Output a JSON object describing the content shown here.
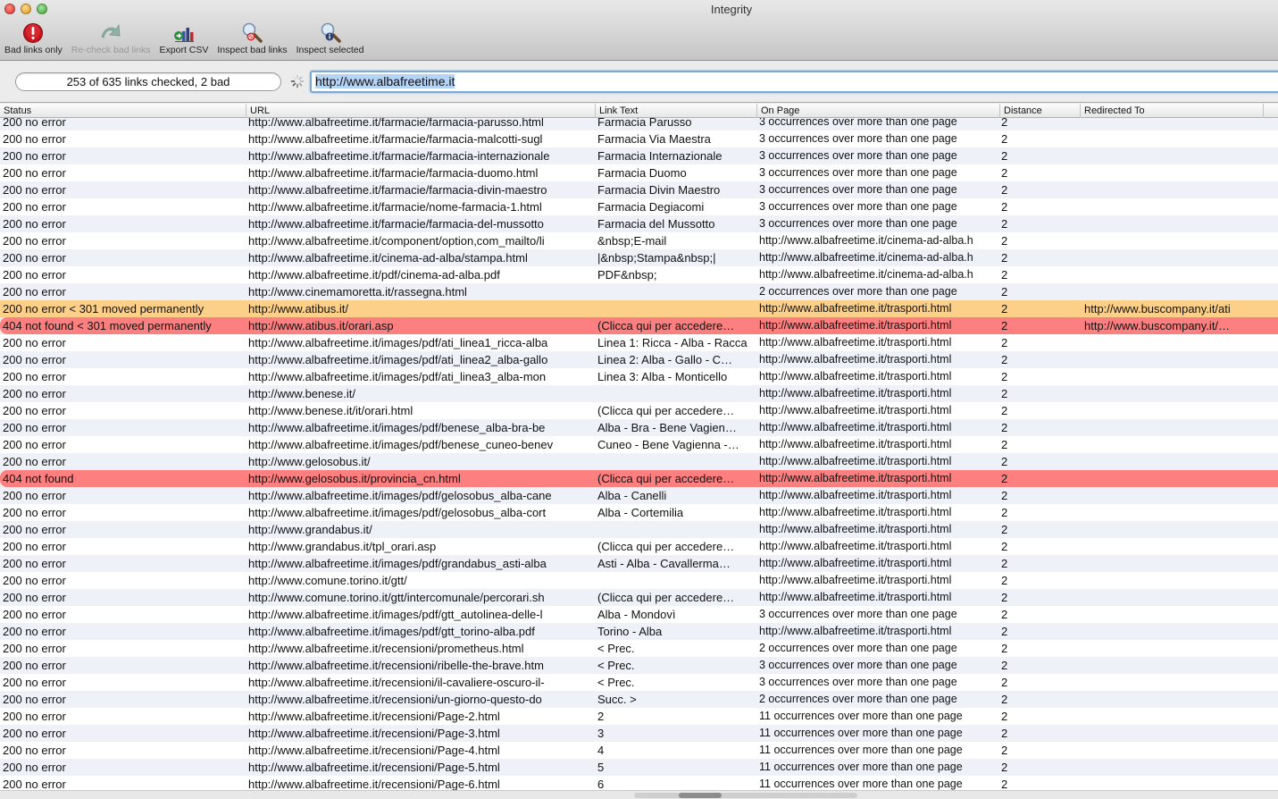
{
  "window": {
    "title": "Integrity"
  },
  "toolbar": {
    "items": [
      {
        "label": "Bad links only",
        "icon": "alert-icon",
        "enabled": true
      },
      {
        "label": "Re-check bad links",
        "icon": "recheck-arrow-icon",
        "enabled": false
      },
      {
        "label": "Export CSV",
        "icon": "export-chart-icon",
        "enabled": true
      },
      {
        "label": "Inspect bad links",
        "icon": "magnifier-bad-icon",
        "enabled": true
      },
      {
        "label": "Inspect selected",
        "icon": "magnifier-info-icon",
        "enabled": true
      }
    ]
  },
  "status": {
    "progress_text": "253 of 635 links checked, 2 bad",
    "checked": 253,
    "total": 635,
    "bad": 2,
    "spinner": "loading-spinner-icon"
  },
  "url_field": {
    "value": "http://www.albafreetime.it"
  },
  "columns": [
    "Status",
    "URL",
    "Link Text",
    "On Page",
    "Distance",
    "Redirected To"
  ],
  "colors": {
    "warn_row": "#fdd08a",
    "bad_row": "#fd7f7f",
    "alt_row": "#eef2f8",
    "focus_ring": "#7fa8d8"
  },
  "rows": [
    {
      "status": "200 no error",
      "url": "http://www.albafreetime.it/farmacie/farmacia-parusso.html",
      "text": "Farmacia Parusso",
      "page": "3 occurrences over more than one page",
      "dist": "2",
      "redir": "",
      "kind": "ok"
    },
    {
      "status": "200 no error",
      "url": "http://www.albafreetime.it/farmacie/farmacia-malcotti-sugl",
      "text": "Farmacia Via Maestra",
      "page": "3 occurrences over more than one page",
      "dist": "2",
      "redir": "",
      "kind": "ok"
    },
    {
      "status": "200 no error",
      "url": "http://www.albafreetime.it/farmacie/farmacia-internazionale",
      "text": "Farmacia Internazionale",
      "page": "3 occurrences over more than one page",
      "dist": "2",
      "redir": "",
      "kind": "ok"
    },
    {
      "status": "200 no error",
      "url": "http://www.albafreetime.it/farmacie/farmacia-duomo.html",
      "text": "Farmacia Duomo",
      "page": "3 occurrences over more than one page",
      "dist": "2",
      "redir": "",
      "kind": "ok"
    },
    {
      "status": "200 no error",
      "url": "http://www.albafreetime.it/farmacie/farmacia-divin-maestro",
      "text": "Farmacia Divin Maestro",
      "page": "3 occurrences over more than one page",
      "dist": "2",
      "redir": "",
      "kind": "ok"
    },
    {
      "status": "200 no error",
      "url": "http://www.albafreetime.it/farmacie/nome-farmacia-1.html",
      "text": "Farmacia Degiacomi",
      "page": "3 occurrences over more than one page",
      "dist": "2",
      "redir": "",
      "kind": "ok"
    },
    {
      "status": "200 no error",
      "url": "http://www.albafreetime.it/farmacie/farmacia-del-mussotto",
      "text": "Farmacia del Mussotto",
      "page": "3 occurrences over more than one page",
      "dist": "2",
      "redir": "",
      "kind": "ok"
    },
    {
      "status": "200 no error",
      "url": "http://www.albafreetime.it/component/option,com_mailto/li",
      "text": "&nbsp;E-mail",
      "page": "http://www.albafreetime.it/cinema-ad-alba.h",
      "dist": "2",
      "redir": "",
      "kind": "ok"
    },
    {
      "status": "200 no error",
      "url": "http://www.albafreetime.it/cinema-ad-alba/stampa.html",
      "text": "|&nbsp;Stampa&nbsp;|",
      "page": "http://www.albafreetime.it/cinema-ad-alba.h",
      "dist": "2",
      "redir": "",
      "kind": "ok"
    },
    {
      "status": "200 no error",
      "url": "http://www.albafreetime.it/pdf/cinema-ad-alba.pdf",
      "text": "PDF&nbsp;",
      "page": "http://www.albafreetime.it/cinema-ad-alba.h",
      "dist": "2",
      "redir": "",
      "kind": "ok"
    },
    {
      "status": "200 no error",
      "url": "http://www.cinemamoretta.it/rassegna.html",
      "text": "",
      "page": "2 occurrences over more than one page",
      "dist": "2",
      "redir": "",
      "kind": "ok"
    },
    {
      "status": "200 no error < 301 moved permanently",
      "url": "http://www.atibus.it/",
      "text": "",
      "page": "http://www.albafreetime.it/trasporti.html",
      "dist": "2",
      "redir": "http://www.buscompany.it/ati",
      "kind": "warn"
    },
    {
      "status": "404 not found < 301 moved permanently",
      "url": "http://www.atibus.it/orari.asp",
      "text": "(Clicca qui per accedere…",
      "page": "http://www.albafreetime.it/trasporti.html",
      "dist": "2",
      "redir": "http://www.buscompany.it/…",
      "kind": "bad"
    },
    {
      "status": "200 no error",
      "url": "http://www.albafreetime.it/images/pdf/ati_linea1_ricca-alba",
      "text": "Linea 1: Ricca - Alba - Racca",
      "page": "http://www.albafreetime.it/trasporti.html",
      "dist": "2",
      "redir": "",
      "kind": "ok"
    },
    {
      "status": "200 no error",
      "url": "http://www.albafreetime.it/images/pdf/ati_linea2_alba-gallo",
      "text": "Linea 2: Alba - Gallo - C…",
      "page": "http://www.albafreetime.it/trasporti.html",
      "dist": "2",
      "redir": "",
      "kind": "ok"
    },
    {
      "status": "200 no error",
      "url": "http://www.albafreetime.it/images/pdf/ati_linea3_alba-mon",
      "text": "Linea 3: Alba - Monticello",
      "page": "http://www.albafreetime.it/trasporti.html",
      "dist": "2",
      "redir": "",
      "kind": "ok"
    },
    {
      "status": "200 no error",
      "url": "http://www.benese.it/",
      "text": "",
      "page": "http://www.albafreetime.it/trasporti.html",
      "dist": "2",
      "redir": "",
      "kind": "ok"
    },
    {
      "status": "200 no error",
      "url": "http://www.benese.it/it/orari.html",
      "text": "(Clicca qui per accedere…",
      "page": "http://www.albafreetime.it/trasporti.html",
      "dist": "2",
      "redir": "",
      "kind": "ok"
    },
    {
      "status": "200 no error",
      "url": "http://www.albafreetime.it/images/pdf/benese_alba-bra-be",
      "text": "Alba - Bra - Bene Vagien…",
      "page": "http://www.albafreetime.it/trasporti.html",
      "dist": "2",
      "redir": "",
      "kind": "ok"
    },
    {
      "status": "200 no error",
      "url": "http://www.albafreetime.it/images/pdf/benese_cuneo-benev",
      "text": "Cuneo - Bene Vagienna -…",
      "page": "http://www.albafreetime.it/trasporti.html",
      "dist": "2",
      "redir": "",
      "kind": "ok"
    },
    {
      "status": "200 no error",
      "url": "http://www.gelosobus.it/",
      "text": "",
      "page": "http://www.albafreetime.it/trasporti.html",
      "dist": "2",
      "redir": "",
      "kind": "ok"
    },
    {
      "status": "404 not found",
      "url": "http://www.gelosobus.it/provincia_cn.html",
      "text": "(Clicca qui per accedere…",
      "page": "http://www.albafreetime.it/trasporti.html",
      "dist": "2",
      "redir": "",
      "kind": "bad"
    },
    {
      "status": "200 no error",
      "url": "http://www.albafreetime.it/images/pdf/gelosobus_alba-cane",
      "text": "Alba - Canelli",
      "page": "http://www.albafreetime.it/trasporti.html",
      "dist": "2",
      "redir": "",
      "kind": "ok"
    },
    {
      "status": "200 no error",
      "url": "http://www.albafreetime.it/images/pdf/gelosobus_alba-cort",
      "text": "Alba - Cortemilia",
      "page": "http://www.albafreetime.it/trasporti.html",
      "dist": "2",
      "redir": "",
      "kind": "ok"
    },
    {
      "status": "200 no error",
      "url": "http://www.grandabus.it/",
      "text": "",
      "page": "http://www.albafreetime.it/trasporti.html",
      "dist": "2",
      "redir": "",
      "kind": "ok"
    },
    {
      "status": "200 no error",
      "url": "http://www.grandabus.it/tpl_orari.asp",
      "text": "(Clicca qui per accedere…",
      "page": "http://www.albafreetime.it/trasporti.html",
      "dist": "2",
      "redir": "",
      "kind": "ok"
    },
    {
      "status": "200 no error",
      "url": "http://www.albafreetime.it/images/pdf/grandabus_asti-alba",
      "text": "Asti - Alba - Cavallerma…",
      "page": "http://www.albafreetime.it/trasporti.html",
      "dist": "2",
      "redir": "",
      "kind": "ok"
    },
    {
      "status": "200 no error",
      "url": "http://www.comune.torino.it/gtt/",
      "text": "",
      "page": "http://www.albafreetime.it/trasporti.html",
      "dist": "2",
      "redir": "",
      "kind": "ok"
    },
    {
      "status": "200 no error",
      "url": "http://www.comune.torino.it/gtt/intercomunale/percorari.sh",
      "text": "(Clicca qui per accedere…",
      "page": "http://www.albafreetime.it/trasporti.html",
      "dist": "2",
      "redir": "",
      "kind": "ok"
    },
    {
      "status": "200 no error",
      "url": "http://www.albafreetime.it/images/pdf/gtt_autolinea-delle-l",
      "text": "Alba - Mondovì",
      "page": "3 occurrences over more than one page",
      "dist": "2",
      "redir": "",
      "kind": "ok"
    },
    {
      "status": "200 no error",
      "url": "http://www.albafreetime.it/images/pdf/gtt_torino-alba.pdf",
      "text": "Torino - Alba",
      "page": "http://www.albafreetime.it/trasporti.html",
      "dist": "2",
      "redir": "",
      "kind": "ok"
    },
    {
      "status": "200 no error",
      "url": "http://www.albafreetime.it/recensioni/prometheus.html",
      "text": "< Prec.",
      "page": "2 occurrences over more than one page",
      "dist": "2",
      "redir": "",
      "kind": "ok"
    },
    {
      "status": "200 no error",
      "url": "http://www.albafreetime.it/recensioni/ribelle-the-brave.htm",
      "text": "< Prec.",
      "page": "3 occurrences over more than one page",
      "dist": "2",
      "redir": "",
      "kind": "ok"
    },
    {
      "status": "200 no error",
      "url": "http://www.albafreetime.it/recensioni/il-cavaliere-oscuro-il-",
      "text": "< Prec.",
      "page": "3 occurrences over more than one page",
      "dist": "2",
      "redir": "",
      "kind": "ok"
    },
    {
      "status": "200 no error",
      "url": "http://www.albafreetime.it/recensioni/un-giorno-questo-do",
      "text": "Succ. >",
      "page": "2 occurrences over more than one page",
      "dist": "2",
      "redir": "",
      "kind": "ok"
    },
    {
      "status": "200 no error",
      "url": "http://www.albafreetime.it/recensioni/Page-2.html",
      "text": "2",
      "page": "11 occurrences over more than one page",
      "dist": "2",
      "redir": "",
      "kind": "ok"
    },
    {
      "status": "200 no error",
      "url": "http://www.albafreetime.it/recensioni/Page-3.html",
      "text": "3",
      "page": "11 occurrences over more than one page",
      "dist": "2",
      "redir": "",
      "kind": "ok"
    },
    {
      "status": "200 no error",
      "url": "http://www.albafreetime.it/recensioni/Page-4.html",
      "text": "4",
      "page": "11 occurrences over more than one page",
      "dist": "2",
      "redir": "",
      "kind": "ok"
    },
    {
      "status": "200 no error",
      "url": "http://www.albafreetime.it/recensioni/Page-5.html",
      "text": "5",
      "page": "11 occurrences over more than one page",
      "dist": "2",
      "redir": "",
      "kind": "ok"
    },
    {
      "status": "200 no error",
      "url": "http://www.albafreetime.it/recensioni/Page-6.html",
      "text": "6",
      "page": "11 occurrences over more than one page",
      "dist": "2",
      "redir": "",
      "kind": "ok"
    }
  ]
}
